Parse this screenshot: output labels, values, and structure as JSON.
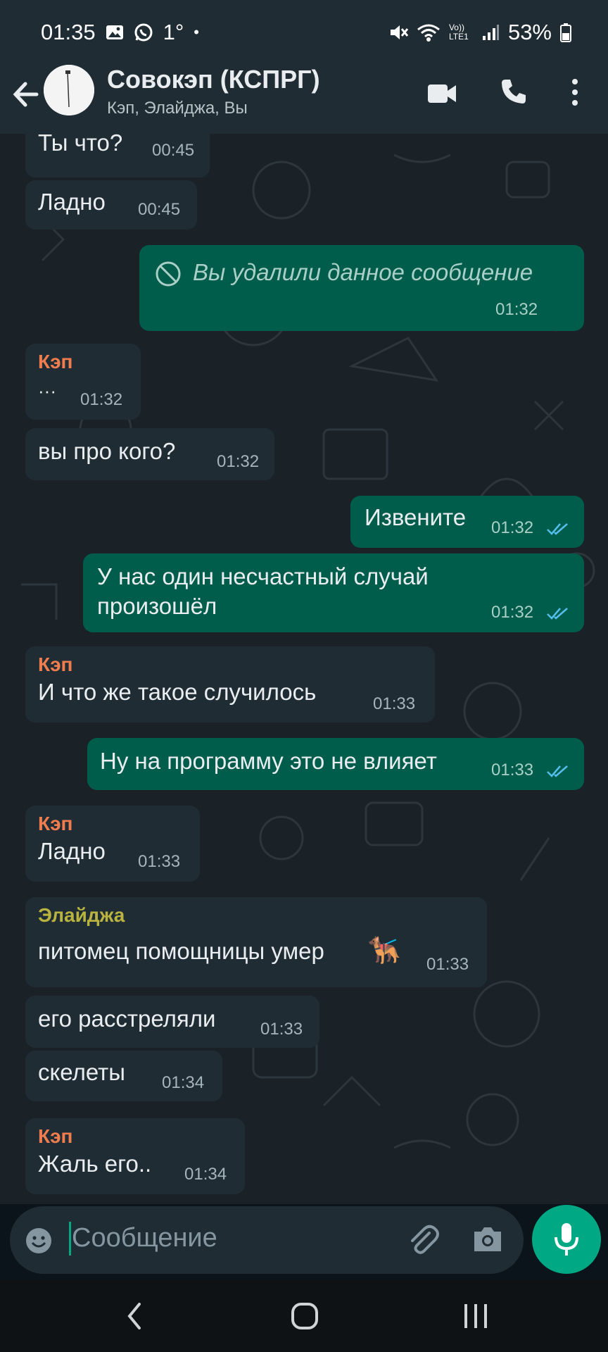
{
  "status_bar": {
    "time": "01:35",
    "temperature": "1°",
    "dot": "•",
    "network_label": "Vo)) LTE1",
    "battery": "53%"
  },
  "header": {
    "title": "Совокэп (КСПРГ)",
    "subtitle": "Кэп, Элайджа, Вы"
  },
  "messages": [
    {
      "dir": "in",
      "text": "Ты что?",
      "time": "00:45"
    },
    {
      "dir": "in",
      "text": "Ладно",
      "time": "00:45"
    },
    {
      "dir": "out",
      "text": "Вы удалили данное сообщение",
      "time": "01:32",
      "deleted": true
    },
    {
      "dir": "in",
      "sender": "Кэп",
      "text": "···",
      "time": "01:32"
    },
    {
      "dir": "in",
      "text": "вы про кого?",
      "time": "01:32"
    },
    {
      "dir": "out",
      "text": "Извените",
      "time": "01:32",
      "read": true
    },
    {
      "dir": "out",
      "text_line1": "У нас один несчастный случай",
      "text_line2": "произошёл",
      "time": "01:32",
      "read": true
    },
    {
      "dir": "in",
      "sender": "Кэп",
      "text": "И что же такое случилось",
      "time": "01:33"
    },
    {
      "dir": "out",
      "text": "Ну на программу это не влияет",
      "time": "01:33",
      "read": true
    },
    {
      "dir": "in",
      "sender": "Кэп",
      "text": "Ладно",
      "time": "01:33"
    },
    {
      "dir": "in",
      "sender": "Элайджа",
      "text": "питомец помощницы умер",
      "emoji": "🐕‍🦺",
      "time": "01:33"
    },
    {
      "dir": "in",
      "text": "его расстреляли",
      "time": "01:33"
    },
    {
      "dir": "in",
      "text": "скелеты",
      "time": "01:34"
    },
    {
      "dir": "in",
      "sender": "Кэп",
      "text": "Жаль его..",
      "time": "01:34"
    }
  ],
  "composer": {
    "placeholder": "Сообщение"
  },
  "colors": {
    "sender_kep": "#f07d4f",
    "sender_elijah": "#b9b33f",
    "accent": "#00a884",
    "incoming_bubble": "#1f2c34",
    "outgoing_bubble": "#005c4b",
    "read_ticks": "#53bdeb"
  },
  "icons": [
    "back-arrow-icon",
    "video-call-icon",
    "phone-icon",
    "more-vert-icon",
    "emoji-icon",
    "attach-icon",
    "camera-icon",
    "mic-icon",
    "deleted-icon",
    "double-tick-icon"
  ]
}
